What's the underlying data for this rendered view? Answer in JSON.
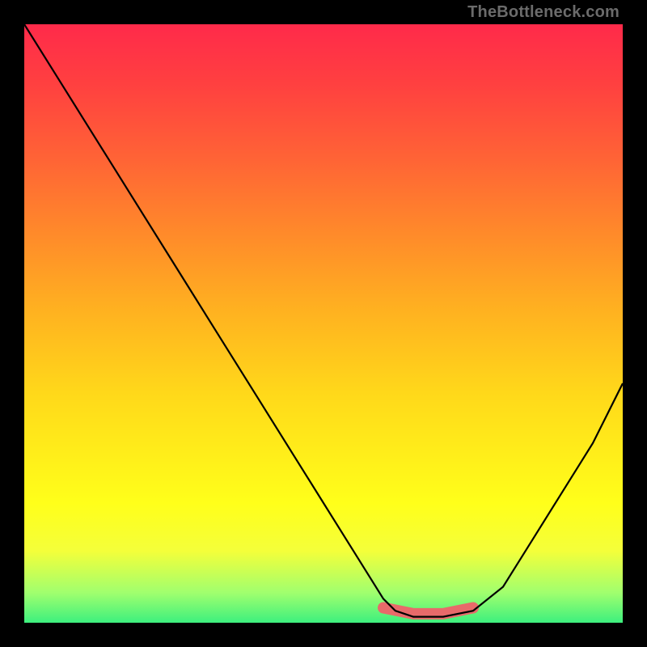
{
  "watermark": "TheBottleneck.com",
  "chart_data": {
    "type": "line",
    "title": "",
    "xlabel": "",
    "ylabel": "",
    "xlim": [
      0,
      100
    ],
    "ylim": [
      0,
      100
    ],
    "grid": false,
    "legend": false,
    "series": [
      {
        "name": "curve",
        "x": [
          0,
          5,
          10,
          15,
          20,
          25,
          30,
          35,
          40,
          45,
          50,
          55,
          60,
          62,
          65,
          70,
          75,
          80,
          85,
          90,
          95,
          100
        ],
        "values": [
          100,
          92,
          84,
          76,
          68,
          60,
          52,
          44,
          36,
          28,
          20,
          12,
          4,
          2,
          1,
          1,
          2,
          6,
          14,
          22,
          30,
          40
        ]
      },
      {
        "name": "highlight",
        "x": [
          60,
          65,
          70,
          75
        ],
        "values": [
          2.5,
          1.5,
          1.5,
          2.5
        ]
      }
    ],
    "background_gradient": {
      "top": "#ff2a4a",
      "bottom": "#3df07e"
    }
  }
}
